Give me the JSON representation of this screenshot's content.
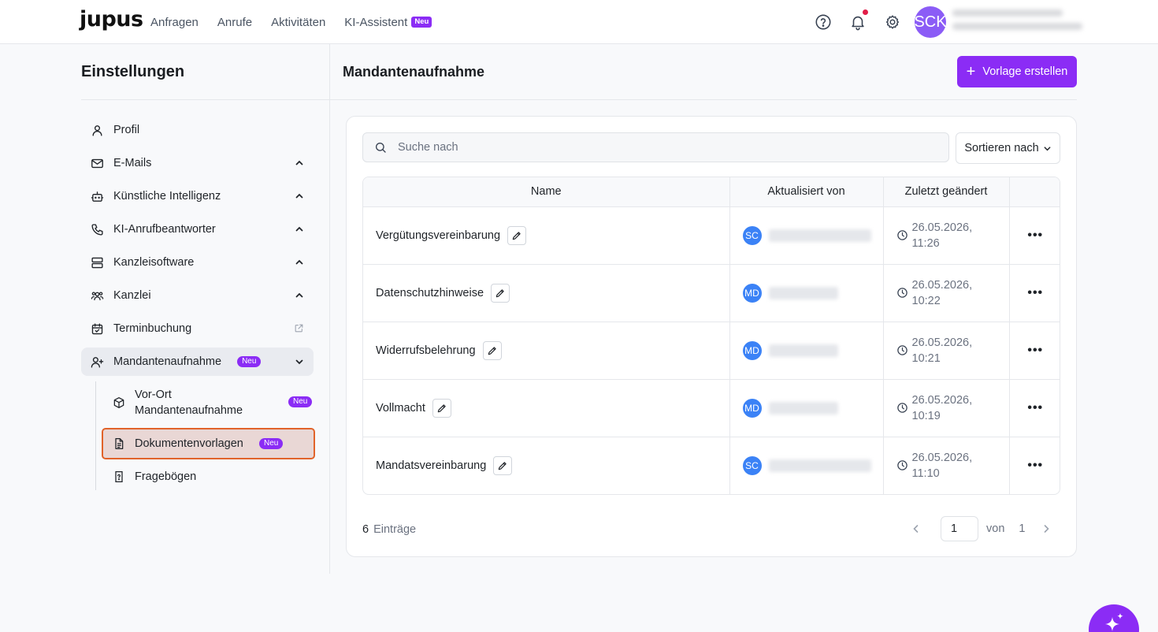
{
  "brand": {
    "logo": "jupus"
  },
  "nav": {
    "items": [
      {
        "label": "Anfragen"
      },
      {
        "label": "Anrufe"
      },
      {
        "label": "Aktivitäten"
      },
      {
        "label": "KI-Assistent",
        "badge": "Neu"
      }
    ]
  },
  "header": {
    "help_icon": "help-circle-icon",
    "notification_icon": "bell-icon",
    "settings_icon": "gear-icon",
    "avatar_initials": "SCK",
    "avatar_color": "#8b5cf6",
    "notification_dot_color": "#e11d48"
  },
  "sidebar": {
    "title": "Einstellungen",
    "items": [
      {
        "label": "Profil",
        "icon": "user-icon"
      },
      {
        "label": "E-Mails",
        "icon": "mail-icon"
      },
      {
        "label": "Künstliche Intelligenz",
        "icon": "robot-icon"
      },
      {
        "label": "KI-Anrufbeantworter",
        "icon": "phone-icon"
      },
      {
        "label": "Kanzleisoftware",
        "icon": "server-icon"
      },
      {
        "label": "Kanzlei",
        "icon": "users-icon"
      },
      {
        "label": "Terminbuchung",
        "icon": "calendar-check-icon"
      },
      {
        "label": "Mandantenaufnahme",
        "icon": "user-plus-icon",
        "badge": "Neu"
      }
    ],
    "subitems": [
      {
        "label": "Vor-Ort Mandantenaufnahme",
        "icon": "box-icon",
        "badge": "Neu"
      },
      {
        "label": "Dokumentenvorlagen",
        "icon": "document-icon",
        "badge": "Neu"
      },
      {
        "label": "Fragebögen",
        "icon": "question-file-icon"
      }
    ]
  },
  "main": {
    "title": "Mandantenaufnahme",
    "create_button": "Vorlage erstellen",
    "search_placeholder": "Suche nach",
    "sort_button": "Sortieren nach",
    "table": {
      "columns": [
        "Name",
        "Aktualisiert von",
        "Zuletzt geändert"
      ],
      "rows": [
        {
          "name": "Vergütungsvereinbarung",
          "initials": "SC",
          "date": "26.05.2026,",
          "time": "11:26"
        },
        {
          "name": "Datenschutzhinweise",
          "initials": "MD",
          "date": "26.05.2026,",
          "time": "10:22"
        },
        {
          "name": "Widerrufsbelehrung",
          "initials": "MD",
          "date": "26.05.2026,",
          "time": "10:21"
        },
        {
          "name": "Vollmacht",
          "initials": "MD",
          "date": "26.05.2026,",
          "time": "10:19"
        },
        {
          "name": "Mandatsvereinbarung",
          "initials": "SC",
          "date": "26.05.2026,",
          "time": "11:10"
        }
      ]
    },
    "footer": {
      "count": "6",
      "count_label": "Einträge",
      "page": "1",
      "of_label": "von",
      "total_pages": "1"
    }
  },
  "colors": {
    "accent": "#8b2cf5",
    "avatar_blue": "#3b82f6",
    "selection_outline": "#e1632a"
  }
}
